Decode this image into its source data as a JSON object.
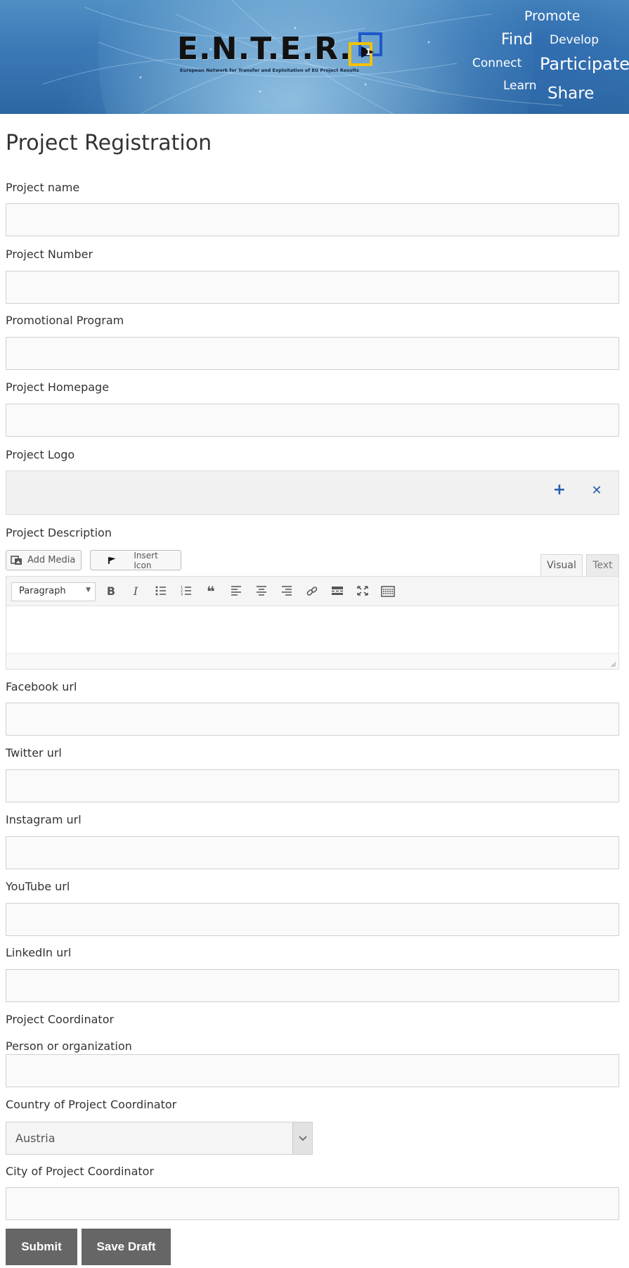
{
  "banner": {
    "logo_text": "E.N.T.E.R.",
    "logo_subtitle": "European Network for Transfer and Exploitation of EU Project Results",
    "words": {
      "promote": "Promote",
      "find": "Find",
      "develop": "Develop",
      "connect": "Connect",
      "participate": "Participate",
      "learn": "Learn",
      "share": "Share"
    }
  },
  "page_title": "Project Registration",
  "fields": {
    "project_name": {
      "label": "Project name",
      "value": ""
    },
    "project_number": {
      "label": "Project Number",
      "value": ""
    },
    "promotional_program": {
      "label": "Promotional Program",
      "value": ""
    },
    "project_homepage": {
      "label": "Project Homepage",
      "value": ""
    },
    "project_logo": {
      "label": "Project Logo"
    },
    "project_description": {
      "label": "Project Description"
    },
    "facebook_url": {
      "label": "Facebook url",
      "value": ""
    },
    "twitter_url": {
      "label": "Twitter url",
      "value": ""
    },
    "instagram_url": {
      "label": "Instagram url",
      "value": ""
    },
    "youtube_url": {
      "label": "YouTube url",
      "value": ""
    },
    "linkedin_url": {
      "label": "LinkedIn url",
      "value": ""
    },
    "coordinator_section": {
      "label": "Project Coordinator"
    },
    "person_or_org": {
      "label": "Person or organization",
      "value": ""
    },
    "country": {
      "label": "Country of Project Coordinator",
      "selected": "Austria"
    },
    "city": {
      "label": "City of Project Coordinator",
      "value": ""
    }
  },
  "editor": {
    "add_media": "Add Media",
    "insert_icon": "Insert Icon",
    "tab_visual": "Visual",
    "tab_text": "Text",
    "format_select": "Paragraph"
  },
  "logo_controls": {
    "add": "+",
    "remove": "✕"
  },
  "buttons": {
    "submit": "Submit",
    "save_draft": "Save Draft"
  },
  "colors": {
    "banner_blue": "#3a78b5",
    "button_gray": "#666666",
    "logo_icon_blue": "#2a5db0",
    "logo_accent_yellow": "#f2c200"
  }
}
